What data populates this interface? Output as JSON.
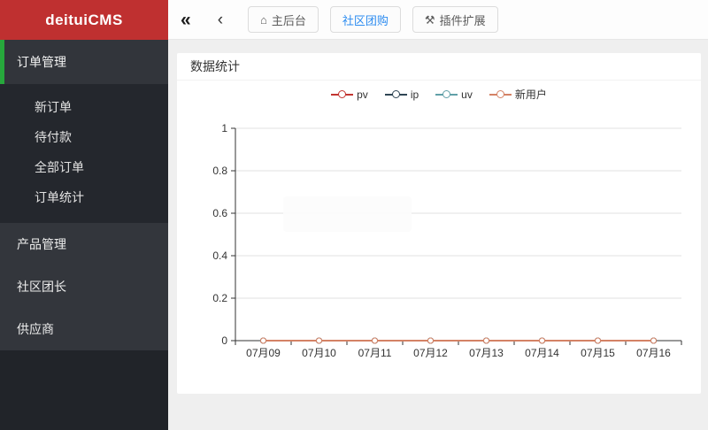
{
  "app": {
    "title": "deituiCMS"
  },
  "sidebar": {
    "parent_item": {
      "label": "订单管理",
      "active": true
    },
    "submenu_items": [
      "新订单",
      "待付款",
      "全部订单",
      "订单统计"
    ],
    "group_items": [
      "产品管理",
      "社区团长",
      "供应商"
    ]
  },
  "topnav": {
    "collapse_icon_glyph": "«",
    "back_icon_glyph": "‹",
    "tabs": [
      {
        "label": "主后台",
        "icon": "home",
        "active": false
      },
      {
        "label": "社区团购",
        "icon": null,
        "active": true
      },
      {
        "label": "插件扩展",
        "icon": "tools",
        "active": false
      }
    ]
  },
  "card": {
    "title": "数据统计"
  },
  "colors": {
    "brand_red": "#bf3030",
    "active_green": "#27a83c",
    "tab_active_blue": "#2d8cf0",
    "axis": "#333333",
    "gridline": "#e0e0e0"
  },
  "chart_data": {
    "type": "line",
    "title": "数据统计",
    "categories": [
      "07月09",
      "07月10",
      "07月11",
      "07月12",
      "07月13",
      "07月14",
      "07月15",
      "07月16"
    ],
    "series": [
      {
        "name": "pv",
        "color": "#c23531",
        "values": [
          0,
          0,
          0,
          0,
          0,
          0,
          0,
          0
        ]
      },
      {
        "name": "ip",
        "color": "#2f4554",
        "values": [
          0,
          0,
          0,
          0,
          0,
          0,
          0,
          0
        ]
      },
      {
        "name": "uv",
        "color": "#61a0a8",
        "values": [
          0,
          0,
          0,
          0,
          0,
          0,
          0,
          0
        ]
      },
      {
        "name": "新用户",
        "color": "#d48265",
        "values": [
          0,
          0,
          0,
          0,
          0,
          0,
          0,
          0
        ]
      }
    ],
    "xlabel": "",
    "ylabel": "",
    "ylim": [
      0,
      1
    ],
    "yticks": [
      0,
      0.2,
      0.4,
      0.6,
      0.8,
      1
    ],
    "legend_position": "top",
    "grid": true,
    "marker": "empty-circle"
  }
}
